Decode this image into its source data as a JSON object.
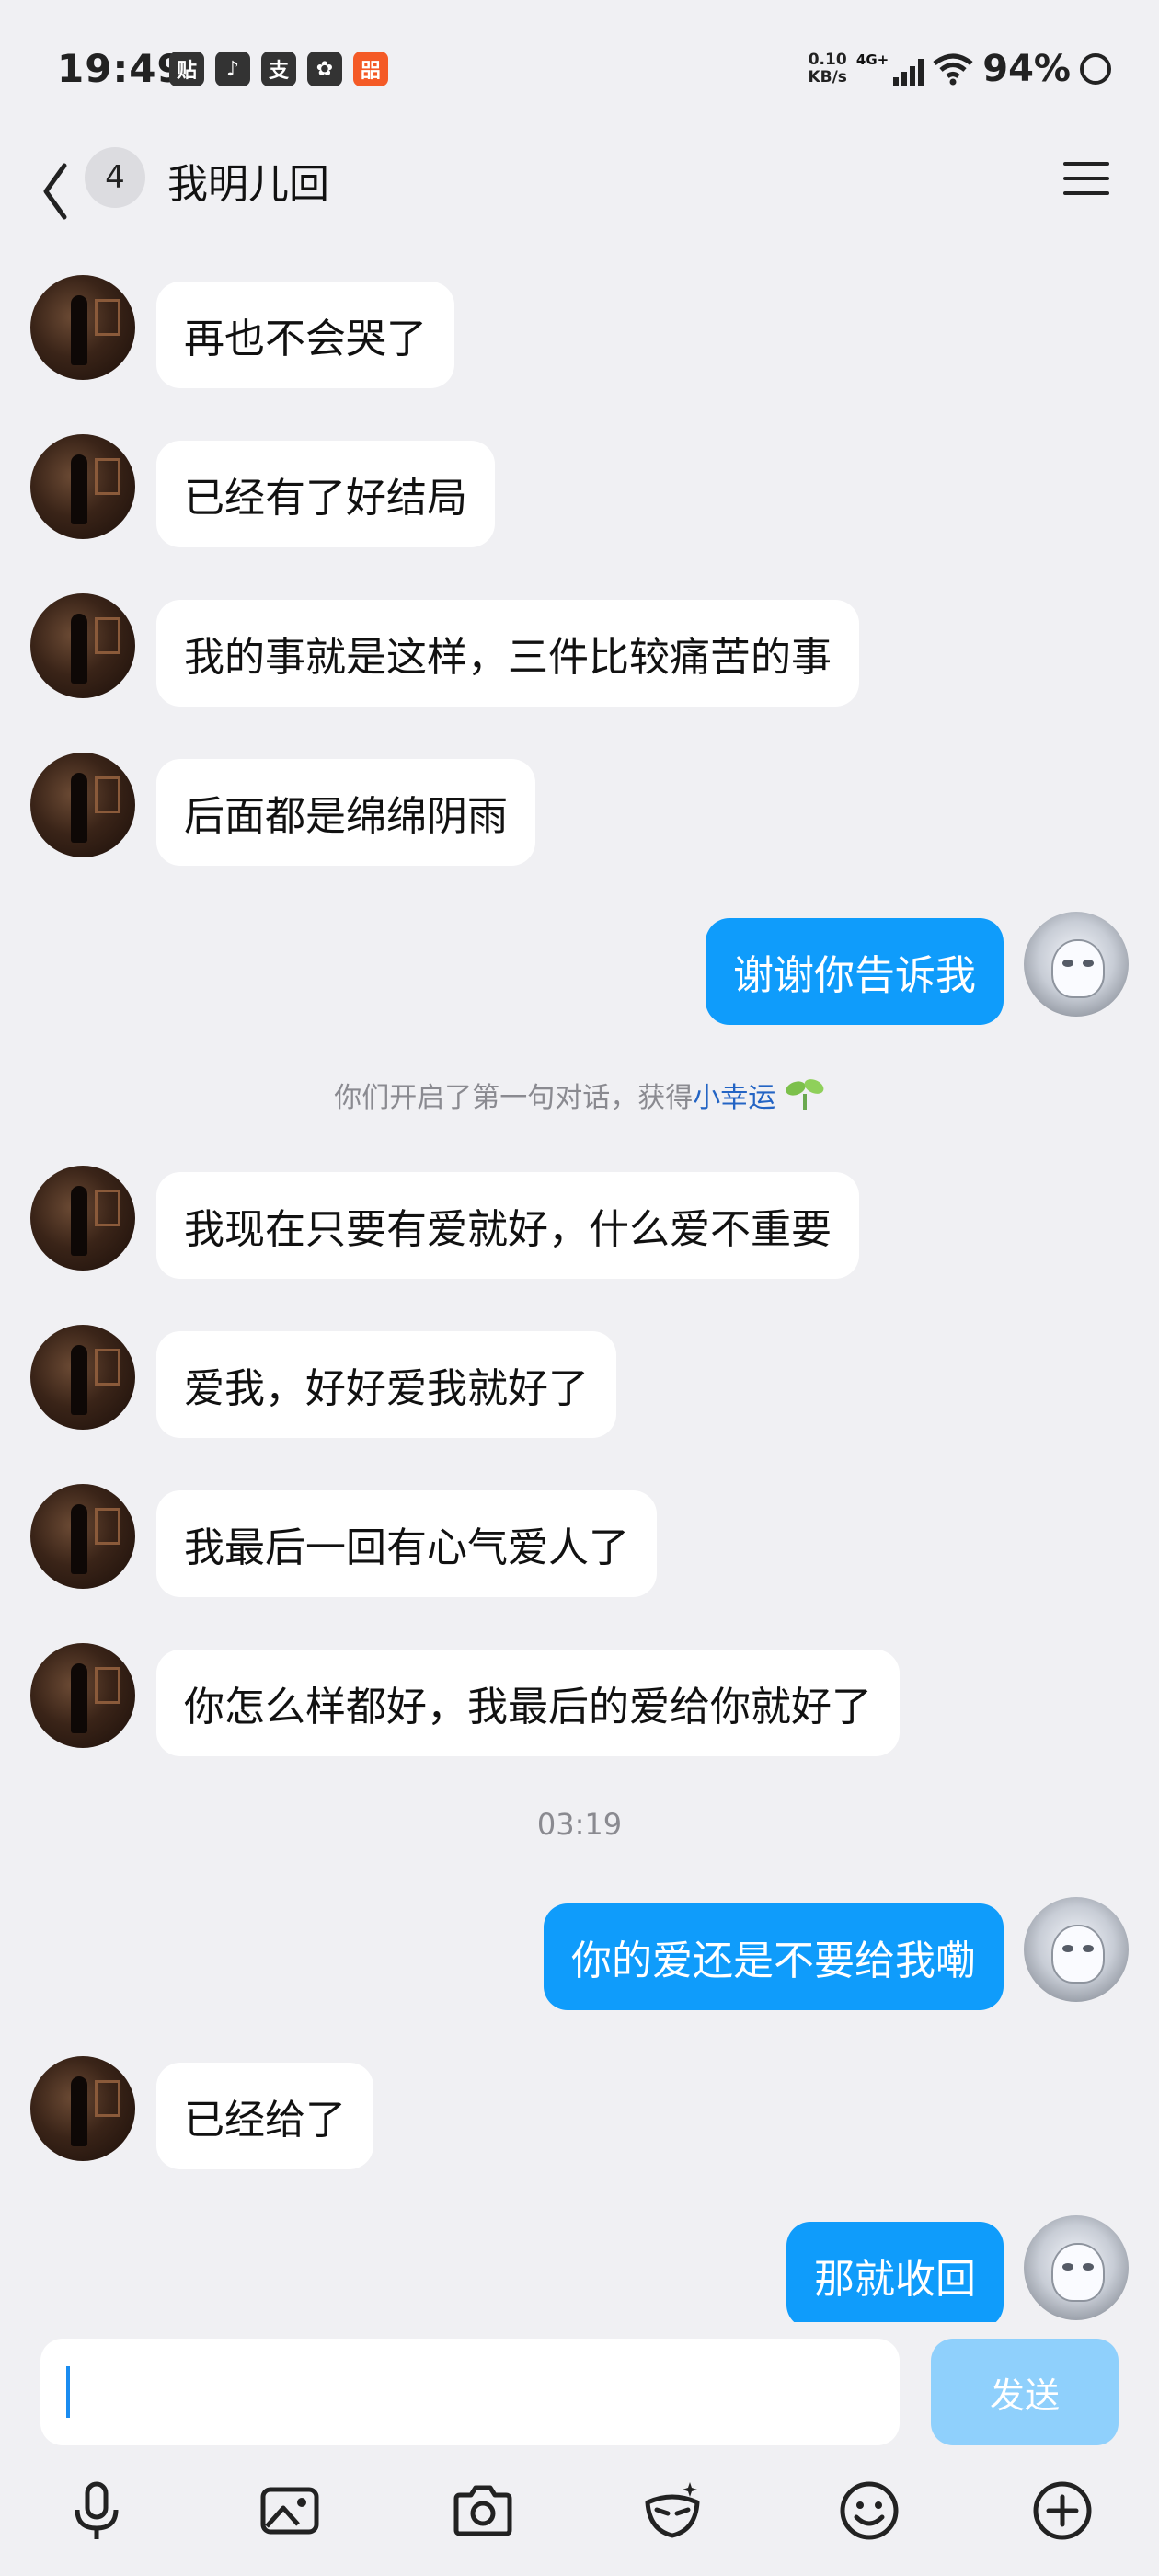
{
  "status_bar": {
    "time": "19:49",
    "app_icons": [
      "贴",
      "♪",
      "支",
      "✿",
      "㗊"
    ],
    "net_speed_value": "0.10",
    "net_speed_unit": "KB/s",
    "network": "4G+",
    "battery": "94%"
  },
  "header": {
    "unread_count": "4",
    "title": "我明儿回"
  },
  "messages": [
    {
      "side": "in",
      "text": "再也不会哭了"
    },
    {
      "side": "in",
      "text": "已经有了好结局"
    },
    {
      "side": "in",
      "text": "我的事就是这样，三件比较痛苦的事"
    },
    {
      "side": "in",
      "text": "后面都是绵绵阴雨"
    },
    {
      "side": "out",
      "text": "谢谢你告诉我"
    },
    {
      "side": "in",
      "text": "我现在只要有爱就好，什么爱不重要"
    },
    {
      "side": "in",
      "text": "爱我，好好爱我就好了"
    },
    {
      "side": "in",
      "text": "我最后一回有心气爱人了"
    },
    {
      "side": "in",
      "text": "你怎么样都好，我最后的爱给你就好了"
    },
    {
      "side": "out",
      "text": "你的爱还是不要给我嘞"
    },
    {
      "side": "in",
      "text": "已经给了"
    },
    {
      "side": "out",
      "text": "那就收回"
    }
  ],
  "system_note": {
    "text": "你们开启了第一句对话，获得",
    "link": "小幸运"
  },
  "timestamp": "03:19",
  "input": {
    "placeholder": "",
    "send_label": "发送"
  },
  "colors": {
    "outgoing_bubble": "#0f9cfb",
    "incoming_bubble": "#ffffff",
    "background": "#f0f0f3",
    "send_button_disabled": "#8fd0fc",
    "link": "#2364c4"
  },
  "toolbar_icons": [
    "microphone-icon",
    "image-icon",
    "camera-icon",
    "mask-icon",
    "emoji-icon",
    "plus-icon"
  ]
}
